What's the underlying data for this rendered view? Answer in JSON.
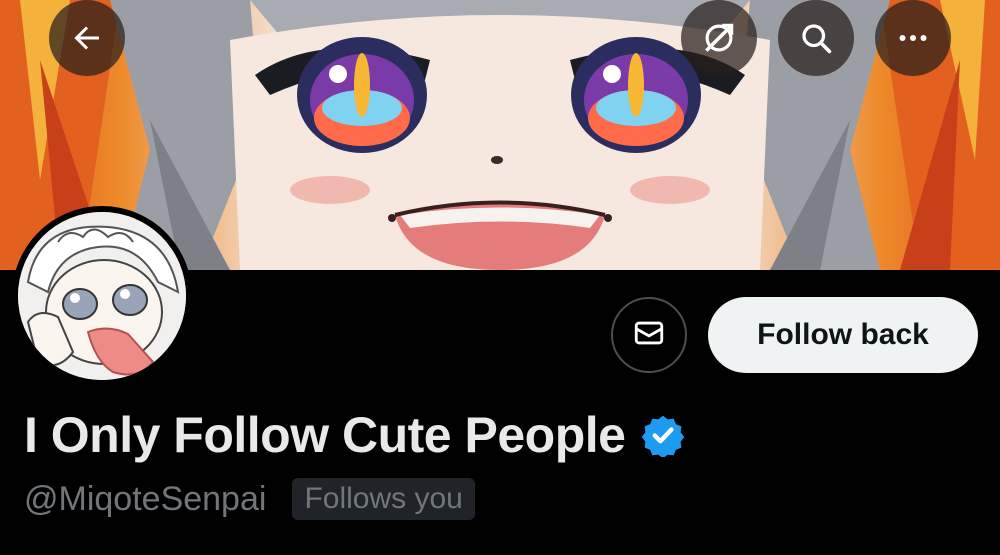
{
  "header": {
    "back_icon": "arrow-left-icon",
    "grok_icon": "grok-icon",
    "search_icon": "search-icon",
    "more_icon": "more-horizontal-icon"
  },
  "profile": {
    "display_name": "I Only Follow Cute People",
    "verified": true,
    "handle": "@MiqoteSenpai",
    "follows_you_label": "Follows you"
  },
  "actions": {
    "message_icon": "envelope-icon",
    "follow_back_label": "Follow back"
  },
  "colors": {
    "background": "#000000",
    "follow_button_bg": "#eff3f4",
    "name_text": "#e7e9ea",
    "secondary_text": "#71767b",
    "verified_blue": "#1d9bf0"
  }
}
